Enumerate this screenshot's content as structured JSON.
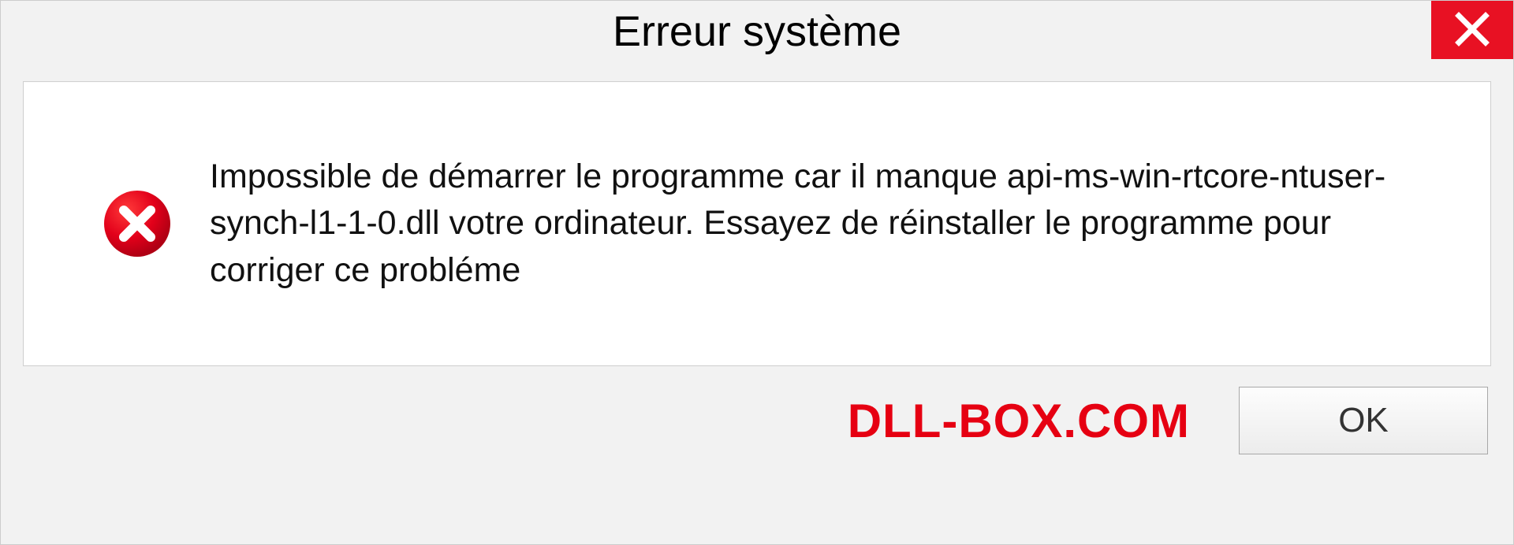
{
  "dialog": {
    "title": "Erreur système",
    "message": "Impossible de démarrer le programme car il manque api-ms-win-rtcore-ntuser-synch-l1-1-0.dll votre ordinateur. Essayez de réinstaller le programme pour corriger ce probléme",
    "ok_label": "OK"
  },
  "watermark": {
    "text": "DLL-BOX.COM"
  },
  "colors": {
    "close_bg": "#e81123",
    "error_icon": "#e2001a",
    "watermark": "#e60012"
  }
}
